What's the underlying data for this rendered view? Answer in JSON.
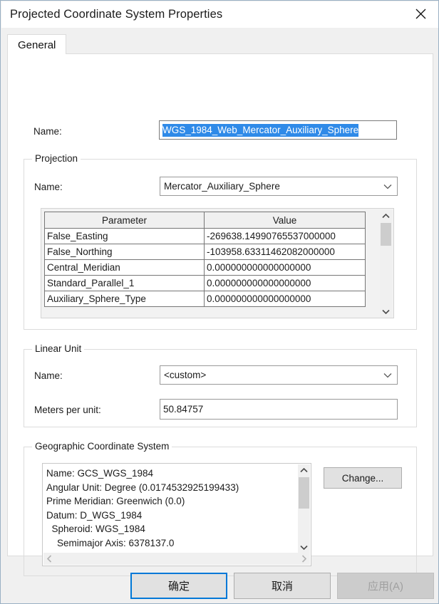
{
  "window": {
    "title": "Projected Coordinate System Properties",
    "close_icon": "close-icon"
  },
  "tabs": [
    {
      "label": "General",
      "active": true
    }
  ],
  "general": {
    "name_label": "Name:",
    "name_value": "WGS_1984_Web_Mercator_Auxiliary_Sphere",
    "name_selected": true
  },
  "projection": {
    "group_title": "Projection",
    "name_label": "Name:",
    "name_value": "Mercator_Auxiliary_Sphere",
    "table": {
      "columns": [
        "Parameter",
        "Value"
      ],
      "rows": [
        [
          "False_Easting",
          "-269638.14990765537000000"
        ],
        [
          "False_Northing",
          "-103958.63311462082000000"
        ],
        [
          "Central_Meridian",
          "0.000000000000000000"
        ],
        [
          "Standard_Parallel_1",
          "0.000000000000000000"
        ],
        [
          "Auxiliary_Sphere_Type",
          "0.000000000000000000"
        ]
      ]
    },
    "scrollbar": {
      "up_icon": "chevron-up-icon",
      "down_icon": "chevron-down-icon"
    }
  },
  "linear_unit": {
    "group_title": "Linear Unit",
    "name_label": "Name:",
    "name_value": "<custom>",
    "meters_label": "Meters per unit:",
    "meters_value": "50.84757"
  },
  "geographic": {
    "group_title": "Geographic Coordinate System",
    "details": "Name: GCS_WGS_1984\nAngular Unit: Degree (0.0174532925199433)\nPrime Meridian: Greenwich (0.0)\nDatum: D_WGS_1984\n  Spheroid: WGS_1984\n    Semimajor Axis: 6378137.0",
    "change_button": "Change...",
    "vscroll": {
      "up_icon": "chevron-up-icon",
      "down_icon": "chevron-down-icon"
    },
    "hscroll": {
      "left_icon": "chevron-left-icon",
      "right_icon": "chevron-right-icon"
    }
  },
  "footer": {
    "ok": "确定",
    "cancel": "取消",
    "apply": "应用(A)",
    "apply_disabled": true
  },
  "colors": {
    "accent": "#0078d7",
    "selection": "#2f8ae8",
    "dialog_bg": "#f0f0f0",
    "panel_bg": "#ffffff",
    "border": "#dcdcdc"
  }
}
